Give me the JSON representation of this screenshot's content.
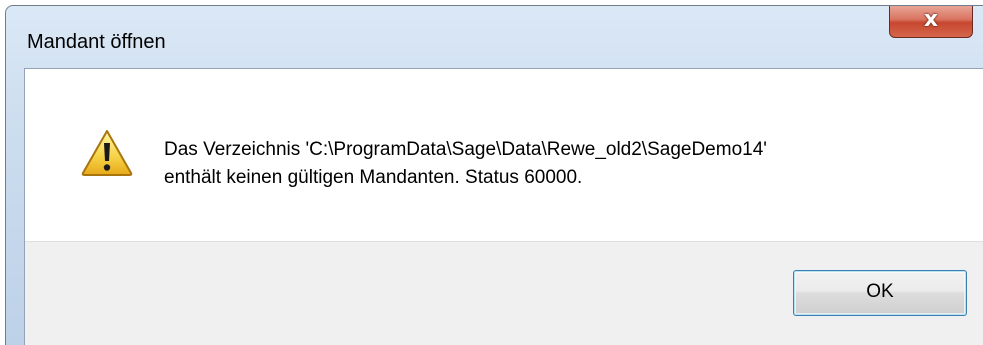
{
  "dialog": {
    "title": "Mandant öffnen",
    "close_label": "x"
  },
  "message": {
    "line1": "Das Verzeichnis 'C:\\ProgramData\\Sage\\Data\\Rewe_old2\\SageDemo14'",
    "line2": "enthält keinen gültigen Mandanten. Status 60000.",
    "icon": "warning-icon"
  },
  "buttons": {
    "ok_label": "OK"
  }
}
